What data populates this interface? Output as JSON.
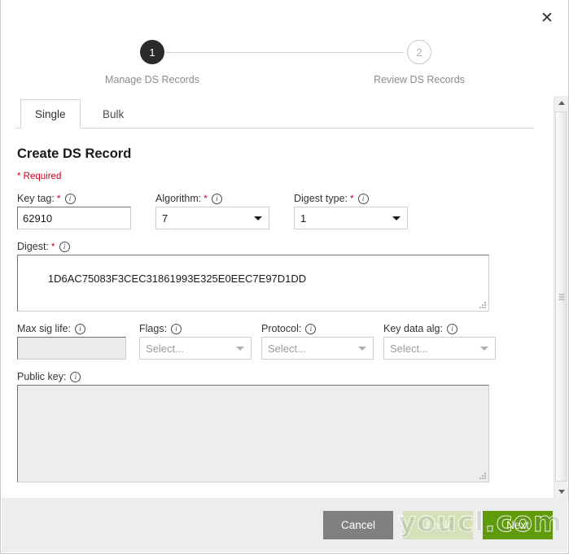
{
  "dialog": {
    "close_label": "✕"
  },
  "stepper": {
    "steps": [
      {
        "number": "1",
        "label": "Manage DS Records",
        "state": "active"
      },
      {
        "number": "2",
        "label": "Review DS Records",
        "state": "inactive"
      }
    ]
  },
  "tabs": [
    {
      "label": "Single",
      "active": true
    },
    {
      "label": "Bulk",
      "active": false
    }
  ],
  "form": {
    "title": "Create DS Record",
    "required_note": "* Required",
    "info_glyph": "i",
    "required_star": "*",
    "key_tag": {
      "label": "Key tag:",
      "value": "62910",
      "required": true
    },
    "algorithm": {
      "label": "Algorithm:",
      "value": "7",
      "required": true
    },
    "digest_type": {
      "label": "Digest type:",
      "value": "1",
      "required": true
    },
    "digest": {
      "label": "Digest:",
      "value": "1D6AC75083F3CEC31861993E325E0EEC7E97D1DD",
      "required": true
    },
    "max_sig_life": {
      "label": "Max sig life:",
      "value": "",
      "disabled": true
    },
    "flags": {
      "label": "Flags:",
      "value": "Select..."
    },
    "protocol": {
      "label": "Protocol:",
      "value": "Select..."
    },
    "key_data_alg": {
      "label": "Key data alg:",
      "value": "Select..."
    },
    "public_key": {
      "label": "Public key:",
      "value": "",
      "disabled": true
    }
  },
  "footer": {
    "cancel_label": "Cancel",
    "back_label": "Back",
    "next_label": "Next"
  },
  "watermark": {
    "text": "youcl.com"
  },
  "colors": {
    "accent_green": "#5f9b0a",
    "back_green": "#d6e1b9",
    "cancel_gray": "#808080",
    "required_red": "#d0021b",
    "step_active": "#2b2b2b"
  }
}
